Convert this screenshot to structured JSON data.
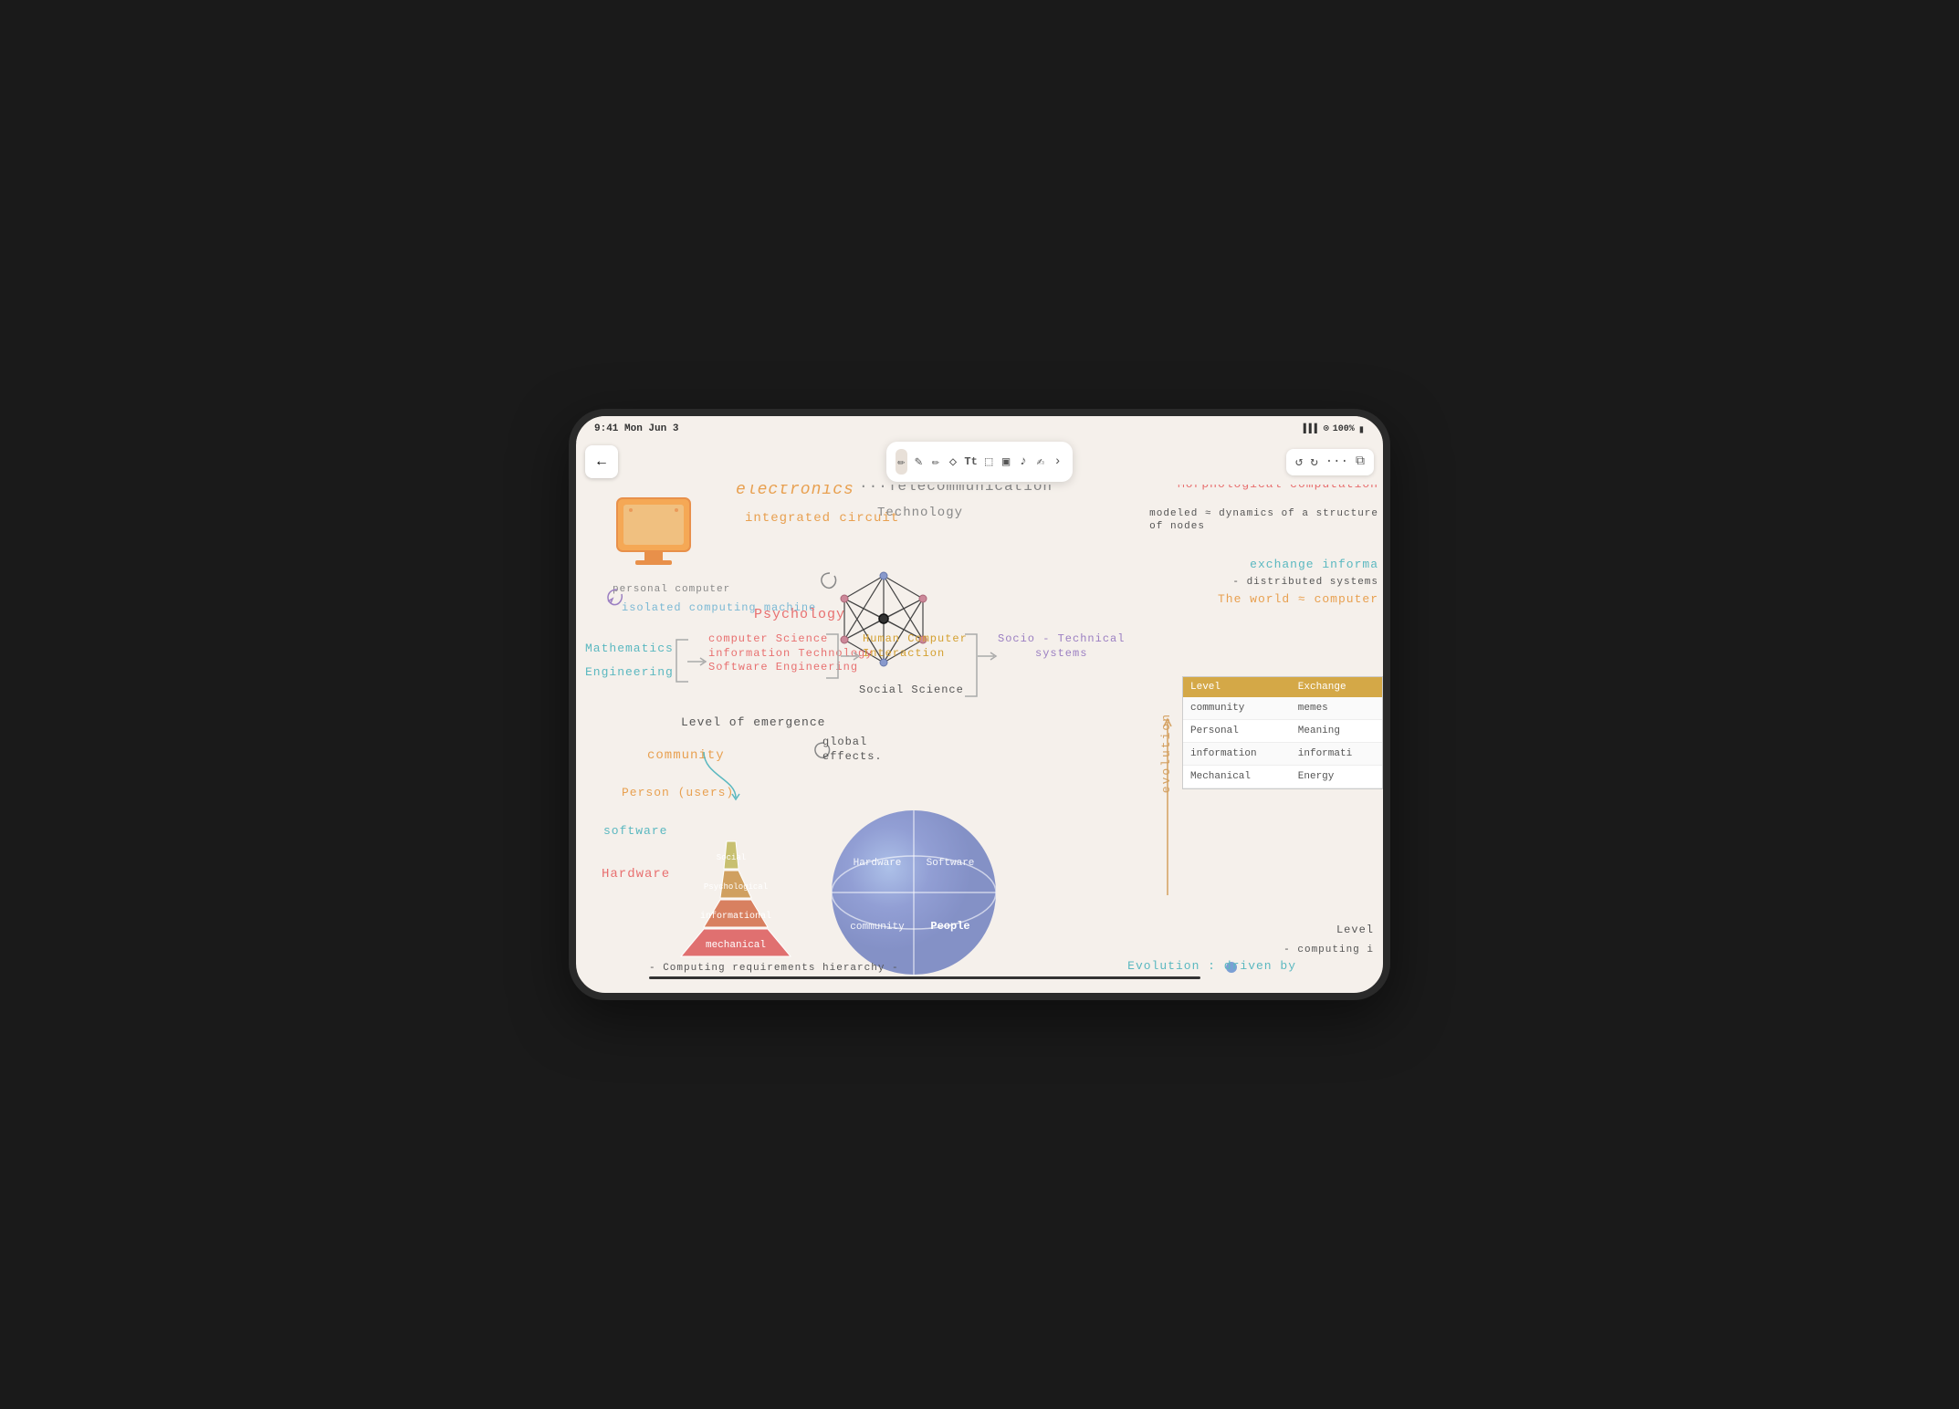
{
  "status": {
    "time": "9:41 Mon Jun 3",
    "battery": "100%",
    "signal": "●●●●",
    "wifi": "WiFi"
  },
  "toolbar": {
    "tools": [
      "✏️",
      "✒️",
      "🖊️",
      "◇",
      "Tt",
      "⬚",
      "🖼",
      "🎤",
      "✍️",
      "›",
      "›"
    ]
  },
  "back_button": "←",
  "texts": {
    "electronics": "electronics",
    "telecom": "···Telecommunication",
    "technology": "Technology",
    "morphological": "Morphological computation",
    "modeled": "modeled ≈ dynamics of a structure\nof nodes",
    "exchange_info": "exchange informa",
    "distributed": "- distributed systems",
    "the_world": "The world ≈ computer",
    "integrated": "integrated circuit",
    "personal_computer": "personal computer",
    "isolated": "isolated computing machine",
    "psychology": "Psychology",
    "mathematics": "Mathematics",
    "engineering": "Engineering",
    "cs_subjects": "computer Science\ninformation Technology\nSoftware Engineering",
    "human_computer": "Human Computer\nInteraction",
    "social_science": "Social Science",
    "socio_technical": "Socio - Technical\nsystems",
    "level_emergence": "Level of emergence",
    "community": "community",
    "person_users": "Person (users)",
    "software_label": "software",
    "hardware_label": "Hardware",
    "global_effects": "global\neffects.",
    "social": "Social",
    "psychological": "Psychological",
    "informational": "informational",
    "mechanical": "mechanical",
    "hardware_sphere": "Hardware",
    "software_sphere": "Software",
    "community_sphere": "community",
    "people_sphere": "People",
    "evolution_label": "evolution",
    "computing_req": "- Computing requirements hierarchy -",
    "evolution_driven": "Evolution : driven by",
    "level_bottom": "Level",
    "computing_bottom": "- computing i"
  },
  "table": {
    "headers": [
      "Level",
      "Exchange"
    ],
    "rows": [
      [
        "community",
        "memes"
      ],
      [
        "Personal",
        "Meaning"
      ],
      [
        "information",
        "informati"
      ],
      [
        "Mechanical",
        "Energy"
      ]
    ]
  }
}
